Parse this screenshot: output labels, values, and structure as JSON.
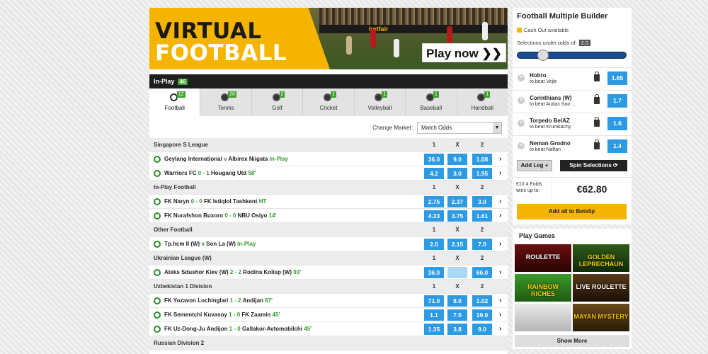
{
  "banner": {
    "line1": "VIRTUAL",
    "line2": "FOOTBALL",
    "play_now": "Play now ❯❯",
    "sponsor": "betfair"
  },
  "inplay": {
    "label": "In-Play",
    "count": "46"
  },
  "sports_tabs": [
    {
      "label": "Football",
      "count": "12"
    },
    {
      "label": "Tennis",
      "count": "28"
    },
    {
      "label": "Golf",
      "count": "2"
    },
    {
      "label": "Cricket",
      "count": "1"
    },
    {
      "label": "Volleyball",
      "count": "1"
    },
    {
      "label": "Baseball",
      "count": "1"
    },
    {
      "label": "Handball",
      "count": "1"
    }
  ],
  "market": {
    "label": "Change Market:",
    "selected": "Match Odds",
    "arrow": "▼"
  },
  "rows": [
    {
      "type": "header",
      "name": "Singapore S League",
      "c1": "1",
      "cx": "X",
      "c2": "2"
    },
    {
      "type": "event",
      "home": "Geylang International",
      "score": "v",
      "away": "Albirex Niigata",
      "status": "In-Play",
      "o1": "36.0",
      "ox": "9.0",
      "o2": "1.08"
    },
    {
      "type": "event",
      "home": "Warriors FC",
      "score": "0 - 1",
      "away": "Hougang Utd",
      "status": "58'",
      "o1": "4.2",
      "ox": "3.0",
      "o2": "1.95"
    },
    {
      "type": "header",
      "name": "In-Play Football",
      "c1": "1",
      "cx": "X",
      "c2": "2"
    },
    {
      "type": "event",
      "home": "FK Naryn",
      "score": "0 - 0",
      "away": "FK Istiqlol Tashkent",
      "status": "HT",
      "o1": "2.75",
      "ox": "2.37",
      "o2": "3.0"
    },
    {
      "type": "event",
      "home": "FK Nurafshon Buxoro",
      "score": "0 - 0",
      "away": "NBU Osiyo",
      "status": "14'",
      "o1": "4.33",
      "ox": "3.75",
      "o2": "1.61"
    },
    {
      "type": "header",
      "name": "Other Football",
      "c1": "1",
      "cx": "X",
      "c2": "2"
    },
    {
      "type": "event",
      "home": "Tp.hcm II (W)",
      "score": "v",
      "away": "Son La (W)",
      "status": "In-Play",
      "o1": "2.0",
      "ox": "2.15",
      "o2": "7.0"
    },
    {
      "type": "header",
      "name": "Ukrainian League (W)",
      "c1": "1",
      "cx": "X",
      "c2": "2"
    },
    {
      "type": "event",
      "home": "Ateks Sdushor Kiev (W)",
      "score": "2 - 2",
      "away": "Rodina Kolisp (W)",
      "status": "93'",
      "o1": "36.0",
      "ox": "",
      "o2": "66.0"
    },
    {
      "type": "header",
      "name": "Uzbekistan 1 Division",
      "c1": "1",
      "cx": "X",
      "c2": "2"
    },
    {
      "type": "event",
      "home": "FK Yozavon Lochinglari",
      "score": "1 - 2",
      "away": "Andijan",
      "status": "87'",
      "o1": "71.0",
      "ox": "8.0",
      "o2": "1.02"
    },
    {
      "type": "event",
      "home": "FK Sementchi Kuvasoy",
      "score": "1 - 0",
      "away": "FK Zaamin",
      "status": "45'",
      "o1": "1.1",
      "ox": "7.5",
      "o2": "19.0"
    },
    {
      "type": "event",
      "home": "FK Uz-Dong-Ju Andijon",
      "score": "1 - 0",
      "away": "Gallakor-Avtomobilchi",
      "status": "45'",
      "o1": "1.35",
      "ox": "3.8",
      "o2": "9.0"
    },
    {
      "type": "header",
      "name": "Russian Division 2",
      "c1": "",
      "cx": "",
      "c2": ""
    }
  ],
  "builder": {
    "title": "Football Multiple Builder",
    "cash_out": "Cash Out available",
    "selections_label": "Selections under odds of:",
    "selections_value": "2.0",
    "slider_level": 0.2,
    "legs": [
      {
        "team": "Hobro",
        "sub": "to beat Vejle",
        "odds": "1.65"
      },
      {
        "team": "Corinthians (W)",
        "sub": "to beat Audax Sao ...",
        "odds": "1.7"
      },
      {
        "team": "Torpedo BelAZ",
        "sub": "to beat Krumkachy",
        "odds": "1.6"
      },
      {
        "team": "Neman Grodno",
        "sub": "to beat Naftan",
        "odds": "1.4"
      }
    ],
    "add_leg": "Add Leg +",
    "spin": "Spin Selections ⟳",
    "wins_label": "€10 4 Folds wins up to:",
    "wins_value": "€62.80",
    "add_all": "Add all to Betslip"
  },
  "games": {
    "title": "Play Games",
    "tiles": [
      "ROULETTE",
      "GOLDEN LEPRECHAUN",
      "RAINBOW RICHES",
      "LIVE ROULETTE",
      "",
      "MAYAN MYSTERY"
    ],
    "show_more": "Show More"
  },
  "colors": {
    "accent": "#f5b400",
    "odds_blue": "#2d9be4",
    "live_green": "#41a22b",
    "dark": "#1e1e1e"
  }
}
